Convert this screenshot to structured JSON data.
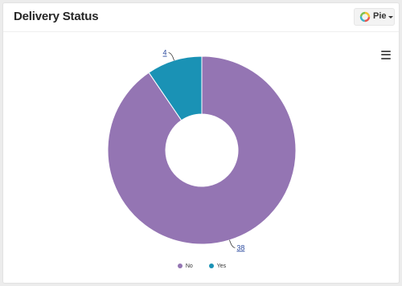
{
  "header": {
    "title": "Delivery Status",
    "chart_type_label": "Pie",
    "chart_type_icon": "donut-icon",
    "menu_icon": "hamburger-menu-icon"
  },
  "chart_data": {
    "type": "pie",
    "variant": "donut",
    "title": "",
    "categories": [
      "No",
      "Yes"
    ],
    "values": [
      38,
      4
    ],
    "colors": [
      "#9475b3",
      "#1a92b5"
    ],
    "legend": {
      "placement": "bottom-center",
      "entries": [
        "No",
        "Yes"
      ]
    },
    "data_labels": [
      "38",
      "4"
    ]
  }
}
